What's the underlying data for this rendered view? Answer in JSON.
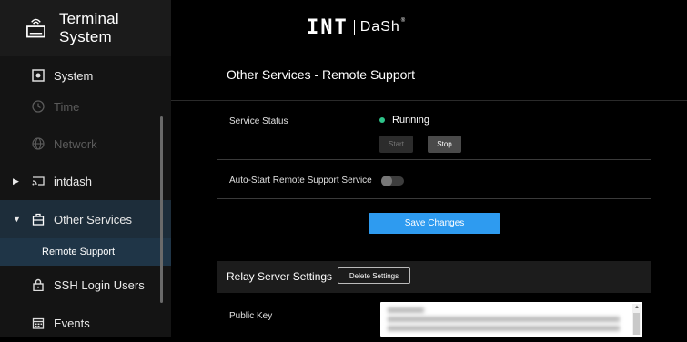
{
  "header": {
    "app_title": "Terminal System",
    "logo_int": "INT",
    "logo_dash": "DaSh",
    "logo_tm": "®"
  },
  "sidebar": {
    "items": [
      {
        "label": "System",
        "icon": "system-icon"
      },
      {
        "label": "Time",
        "icon": "clock-icon"
      },
      {
        "label": "Network",
        "icon": "globe-icon"
      },
      {
        "label": "intdash",
        "icon": "cast-icon"
      },
      {
        "label": "Other Services",
        "icon": "services-icon"
      },
      {
        "label": "Remote Support"
      },
      {
        "label": "SSH Login Users",
        "icon": "lock-icon"
      },
      {
        "label": "Events",
        "icon": "calendar-icon"
      }
    ]
  },
  "main": {
    "title": "Other Services - Remote Support",
    "service_status_label": "Service Status",
    "status_value": "Running",
    "start_label": "Start",
    "stop_label": "Stop",
    "auto_start_label": "Auto-Start Remote Support Service",
    "auto_start_enabled": false,
    "save_label": "Save Changes",
    "relay_title": "Relay Server Settings",
    "delete_label": "Delete Settings",
    "public_key_label": "Public Key"
  },
  "colors": {
    "accent": "#2e9bf0",
    "status_ok": "#2ec48a",
    "sidebar_active": "#1f3547"
  }
}
